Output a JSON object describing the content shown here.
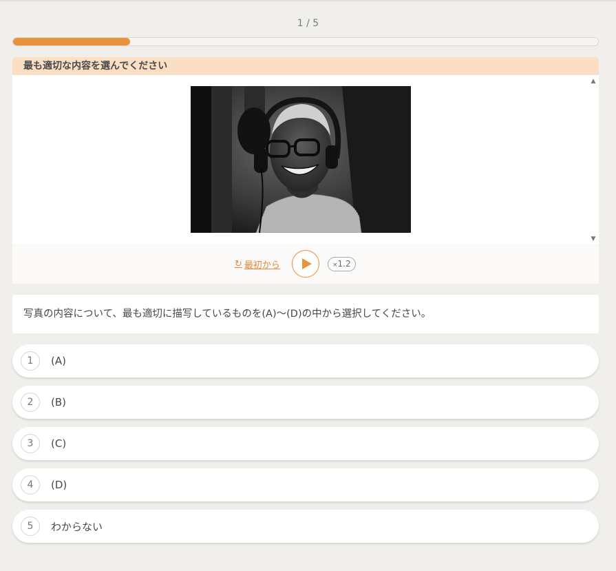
{
  "progress": {
    "counter": "1 / 5",
    "fraction": 0.2
  },
  "question": {
    "header": "最も適切な内容を選んでください",
    "instruction": "写真の内容について、最も適切に描写しているものを(A)～(D)の中から選択してください。"
  },
  "icons": {
    "scroll_up": "triangle-up-icon",
    "scroll_down": "triangle-down-icon",
    "restart": "refresh-icon",
    "play": "play-icon"
  },
  "audio": {
    "restart_label": "最初から",
    "speed_prefix": "×",
    "speed_value": "1.2"
  },
  "options": [
    {
      "num": "1",
      "label": "(A)"
    },
    {
      "num": "2",
      "label": "(B)"
    },
    {
      "num": "3",
      "label": "(C)"
    },
    {
      "num": "4",
      "label": "(D)"
    },
    {
      "num": "5",
      "label": "わからない"
    }
  ],
  "colors": {
    "accent": "#e8923c",
    "header_bg": "#fbdfc5",
    "page_bg": "#f0efec"
  }
}
